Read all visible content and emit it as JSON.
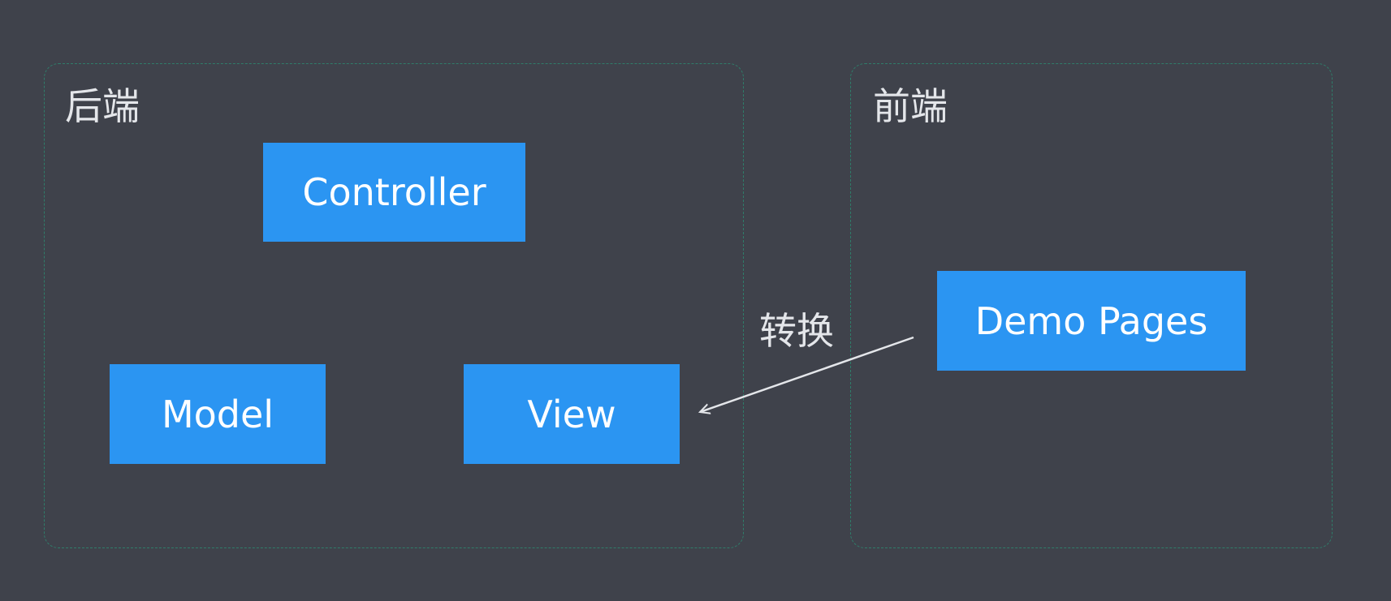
{
  "groups": {
    "backend": {
      "title": "后端"
    },
    "frontend": {
      "title": "前端"
    }
  },
  "nodes": {
    "controller": "Controller",
    "model": "Model",
    "view": "View",
    "demo_pages": "Demo Pages"
  },
  "edge": {
    "label": "转换",
    "from": "Demo Pages",
    "to": "View"
  },
  "colors": {
    "background": "#3f424b",
    "node_fill": "#2b95f2",
    "group_border": "#2f7d6a",
    "text": "#e4e6ea",
    "arrow": "#e4e6ea"
  }
}
